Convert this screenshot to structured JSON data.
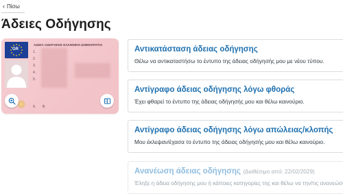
{
  "nav": {
    "back_label": "Πίσω"
  },
  "page": {
    "title": "Άδειες Οδήγησης"
  },
  "license_card": {
    "header_text": "ΑΔΕΙΑ ΟΔΗΓΗΣΗΣ ΕΛΛΗΝΙΚΗ ΔΗΜΟΚΡΑΤΙΑ",
    "country_code": "GR",
    "field_numbers": [
      "1.",
      "2.",
      "3.",
      "4.",
      "5.",
      "9."
    ],
    "category_letter": "B"
  },
  "services": [
    {
      "title": "Αντικατάσταση άδειας οδήγησης",
      "note": "",
      "description": "Θέλω να αντικαταστήσω το έντυπο της άδειας οδήγησής μου με νέου τύπου.",
      "disabled": false
    },
    {
      "title": "Αντίγραφο άδειας οδήγησης λόγω φθοράς",
      "note": "",
      "description": "Έχει φθαρεί το έντυπο της άδειας οδήγησής μου και θέλω καινούριο.",
      "disabled": false
    },
    {
      "title": "Αντίγραφο άδειας οδήγησης λόγω απώλειας/κλοπής",
      "note": "",
      "description": "Μου έκλεψαν/έχασα το έντυπο της άδειας οδήγησής μου και θέλω καινούριο.",
      "disabled": false
    },
    {
      "title": "Ανανέωση άδειας οδήγησης",
      "note": "(Διαθέσιμο από: 22/02/2029)",
      "description": "Έληξε η άδεια οδήγησης μου ή κάποιες κατηγορίες της και θέλω να την/τις ανανεώσω.",
      "disabled": true
    }
  ],
  "colors": {
    "link_blue": "#1d6fae",
    "disabled_blue": "#8fbde0",
    "card_pink": "#f3c6cb",
    "eu_blue": "#1d3f95"
  }
}
